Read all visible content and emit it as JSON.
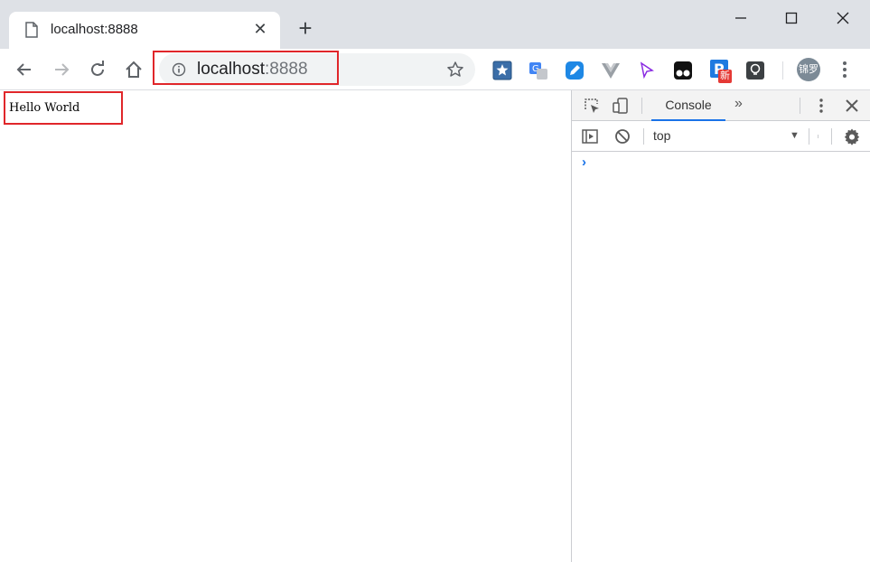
{
  "tab": {
    "title": "localhost:8888",
    "close_glyph": "✕"
  },
  "new_tab_glyph": "+",
  "address": {
    "host": "localhost",
    "port": ":8888"
  },
  "profile": {
    "label": "锦罗"
  },
  "extensions": {
    "badge_new": "新"
  },
  "page": {
    "text": "Hello World"
  },
  "devtools": {
    "tabs": {
      "console": "Console",
      "more": "»"
    },
    "context": "top",
    "prompt": "›"
  },
  "colors": {
    "tabstrip": "#dee1e6",
    "highlight": "#e0262a",
    "accent": "#1a73e8"
  },
  "icons": [
    "file-icon",
    "close-icon",
    "plus-icon",
    "minimize-icon",
    "maximize-icon",
    "window-close-icon",
    "back-arrow-icon",
    "forward-arrow-icon",
    "reload-icon",
    "home-icon",
    "info-icon",
    "star-icon",
    "kebab-menu-icon",
    "inspect-element-icon",
    "device-toolbar-icon",
    "sidebar-toggle-icon",
    "clear-console-icon",
    "gear-icon"
  ]
}
